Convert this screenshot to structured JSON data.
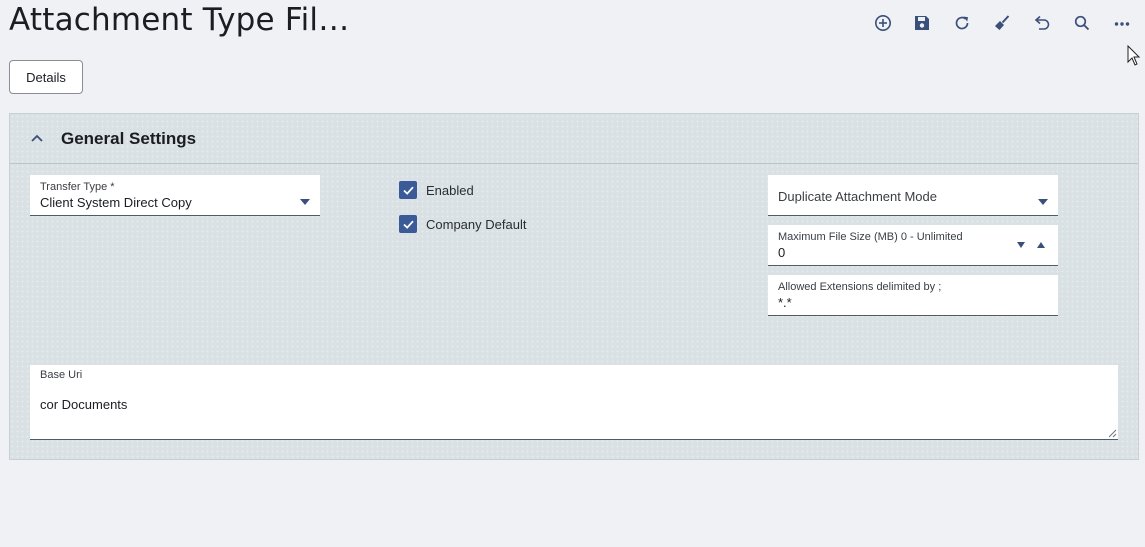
{
  "page": {
    "title": "Attachment Type Fil…"
  },
  "toolbar": {
    "buttons": [
      {
        "name": "add-icon"
      },
      {
        "name": "save-icon"
      },
      {
        "name": "refresh-icon"
      },
      {
        "name": "clear-icon"
      },
      {
        "name": "undo-icon"
      },
      {
        "name": "search-icon"
      },
      {
        "name": "more-icon"
      }
    ]
  },
  "tabs": {
    "details_label": "Details"
  },
  "section": {
    "title": "General Settings",
    "expanded": true
  },
  "fields": {
    "transfer_type": {
      "label": "Transfer Type *",
      "value": "Client System Direct Copy"
    },
    "enabled": {
      "label": "Enabled",
      "checked": true
    },
    "company_default": {
      "label": "Company Default",
      "checked": true
    },
    "duplicate_mode": {
      "label": "Duplicate Attachment Mode",
      "value": ""
    },
    "max_file_size": {
      "label": "Maximum File Size (MB) 0 - Unlimited",
      "value": "0"
    },
    "allowed_extensions": {
      "label": "Allowed Extensions delimited by ;",
      "value": "*.*"
    },
    "base_uri": {
      "label": "Base Uri",
      "value": "cor Documents"
    }
  },
  "colors": {
    "accent": "#3a5a98",
    "section_bg": "#d9e1e4",
    "page_bg": "#f0f1f5",
    "icon": "#3a4f7a"
  }
}
